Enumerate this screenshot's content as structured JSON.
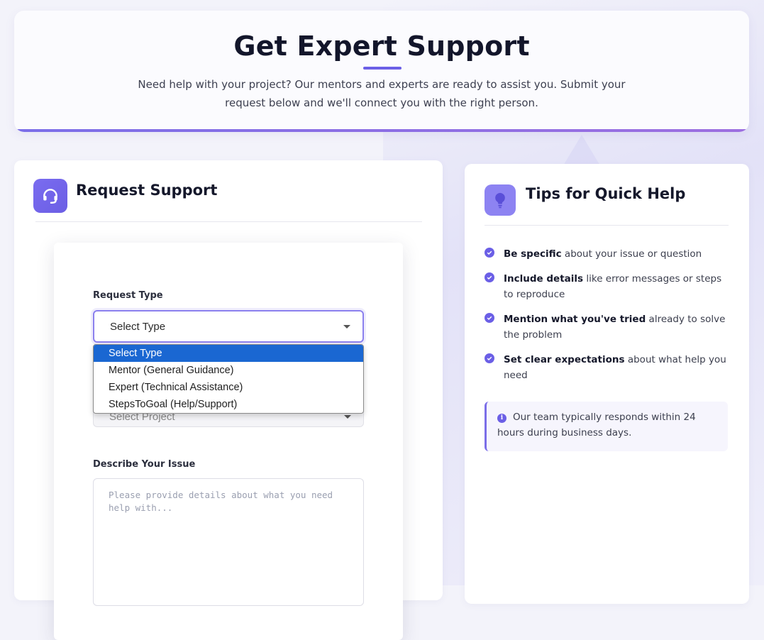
{
  "hero": {
    "title": "Get Expert Support",
    "subtitle": "Need help with your project? Our mentors and experts are ready to assist you. Submit your request below and we'll connect you with the right person."
  },
  "request_card": {
    "icon": "headset-icon",
    "title": "Request Support",
    "request_type": {
      "label": "Request Type",
      "selected": "Select Type",
      "options": [
        "Select Type",
        "Mentor (General Guidance)",
        "Expert (Technical Assistance)",
        "StepsToGoal (Help/Support)"
      ]
    },
    "project_select": {
      "value": "Select Project"
    },
    "issue": {
      "label": "Describe Your Issue",
      "placeholder": "Please provide details about what you need help with..."
    }
  },
  "tips_card": {
    "icon": "lightbulb-icon",
    "title": "Tips for Quick Help",
    "tips": [
      {
        "bold": "Be specific",
        "rest": " about your issue or question"
      },
      {
        "bold": "Include details",
        "rest": " like error messages or steps to reproduce"
      },
      {
        "bold": "Mention what you've tried",
        "rest": " already to solve the problem"
      },
      {
        "bold": "Set clear expectations",
        "rest": " about what help you need"
      }
    ],
    "note": "Our team typically responds within 24 hours during business days."
  },
  "colors": {
    "accent": "#6b5fe6",
    "selected_option": "#1a67d2",
    "background": "#f3f3fa"
  }
}
